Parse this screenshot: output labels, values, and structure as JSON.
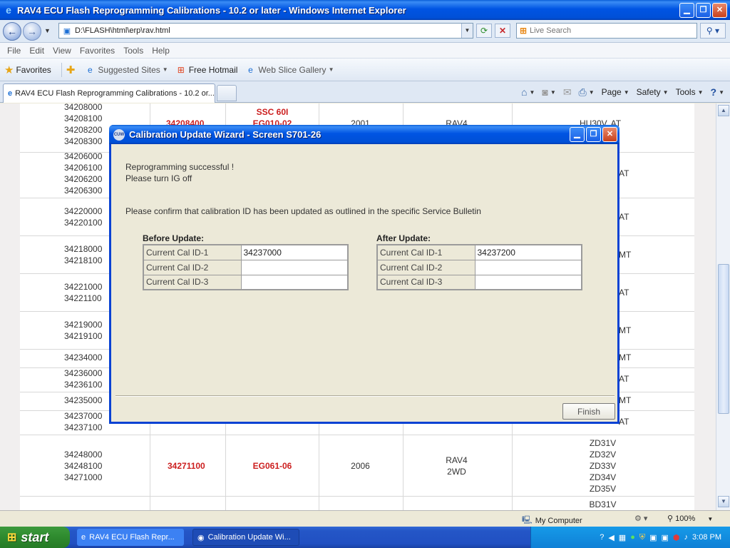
{
  "window": {
    "title": "RAV4 ECU Flash Reprogramming Calibrations - 10.2 or later - Windows Internet Explorer",
    "url": "D:\\FLASH\\html\\erp\\rav.html",
    "search_placeholder": "Live Search"
  },
  "menu": [
    "File",
    "Edit",
    "View",
    "Favorites",
    "Tools",
    "Help"
  ],
  "favorites_bar": {
    "favorites_label": "Favorites",
    "links": [
      "Suggested Sites",
      "Free Hotmail",
      "Web Slice Gallery"
    ]
  },
  "tab": {
    "label": "RAV4 ECU Flash Reprogramming Calibrations - 10.2 or..."
  },
  "command_bar": [
    "Page",
    "Safety",
    "Tools"
  ],
  "background_table": {
    "rows": [
      {
        "cals": "34208000\n34208100\n34208200\n34208300",
        "new_cal": "34208400",
        "bulletin": "SSC 60I\nEG010-02",
        "year": "2001",
        "model": "RAV4",
        "engine": "HU30V, AT"
      },
      {
        "cals": "34206000\n34206100\n34206200\n34206300",
        "engine": "AT"
      },
      {
        "cals": "34220000\n34220100",
        "engine": "AT"
      },
      {
        "cals": "34218000\n34218100",
        "engine": "MT"
      },
      {
        "cals": "34221000\n34221100",
        "engine": "AT"
      },
      {
        "cals": "34219000\n34219100",
        "engine": "MT"
      },
      {
        "cals": "34234000",
        "engine": "MT"
      },
      {
        "cals": "34236000\n34236100",
        "engine": "AT"
      },
      {
        "cals": "34235000",
        "engine": "MT"
      },
      {
        "cals": "34237000\n34237100",
        "engine": "AT"
      },
      {
        "cals": "34248000\n34248100\n34271000",
        "new_cal": "34271100",
        "bulletin": "EG061-06",
        "year": "2006",
        "model": "RAV4\n2WD",
        "engine": "ZD31V\nZD32V\nZD33V\nZD34V\nZD35V"
      },
      {
        "cals": "",
        "engine": "BD31V"
      }
    ]
  },
  "status_bar": {
    "zone": "My Computer",
    "zoom": "100%"
  },
  "taskbar": {
    "start": "start",
    "tasks": [
      "RAV4 ECU Flash Repr...",
      "Calibration Update Wi..."
    ],
    "clock": "3:08 PM"
  },
  "dialog": {
    "title": "Calibration Update Wizard - Screen S701-26",
    "icon_text": "CUW",
    "message_line1": "Reprogramming successful !",
    "message_line2": "Please turn IG off",
    "confirm_text": "Please confirm that calibration ID has been updated as outlined in the specific Service Bulletin",
    "before": {
      "heading": "Before Update:",
      "rows": [
        {
          "label": "Current Cal ID-1",
          "value": "34237000"
        },
        {
          "label": "Current Cal ID-2",
          "value": ""
        },
        {
          "label": "Current Cal ID-3",
          "value": ""
        }
      ]
    },
    "after": {
      "heading": "After Update:",
      "rows": [
        {
          "label": "Current Cal ID-1",
          "value": "34237200"
        },
        {
          "label": "Current Cal ID-2",
          "value": ""
        },
        {
          "label": "Current Cal ID-3",
          "value": ""
        }
      ]
    },
    "finish_label": "Finish"
  }
}
